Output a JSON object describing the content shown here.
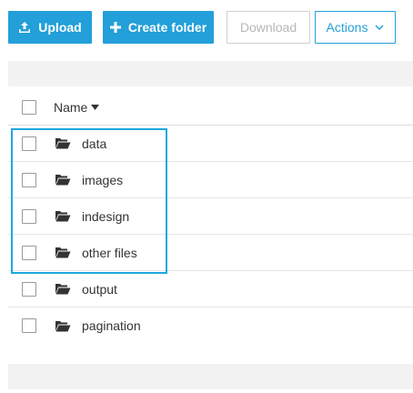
{
  "toolbar": {
    "upload_label": "Upload",
    "create_folder_label": "Create folder",
    "download_label": "Download",
    "actions_label": "Actions"
  },
  "table": {
    "header": {
      "name_label": "Name"
    },
    "rows": [
      {
        "name": "data"
      },
      {
        "name": "images"
      },
      {
        "name": "indesign"
      },
      {
        "name": "other files"
      },
      {
        "name": "output"
      },
      {
        "name": "pagination"
      }
    ]
  },
  "colors": {
    "accent": "#239fd9",
    "highlight_border": "#1ea7df",
    "bar_gray": "#f2f2f2"
  }
}
